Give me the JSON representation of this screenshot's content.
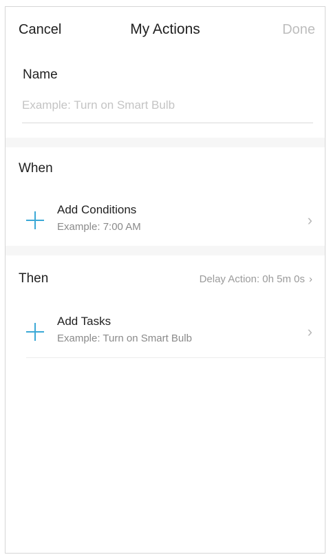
{
  "nav": {
    "cancel_label": "Cancel",
    "title": "My Actions",
    "done_label": "Done"
  },
  "name": {
    "label": "Name",
    "placeholder": "Example: Turn on Smart Bulb",
    "value": ""
  },
  "when": {
    "title": "When",
    "add_conditions": {
      "title": "Add Conditions",
      "example": "Example: 7:00 AM"
    }
  },
  "then": {
    "title": "Then",
    "delay_label": "Delay Action: 0h 5m 0s",
    "add_tasks": {
      "title": "Add Tasks",
      "example": "Example: Turn on Smart Bulb"
    }
  },
  "icons": {
    "plus": "plus-icon",
    "chevron": "chevron-right-icon"
  },
  "colors": {
    "accent": "#3aa8d6",
    "disabled_text": "#bdbdbd",
    "secondary_text": "#8a8a8a"
  }
}
